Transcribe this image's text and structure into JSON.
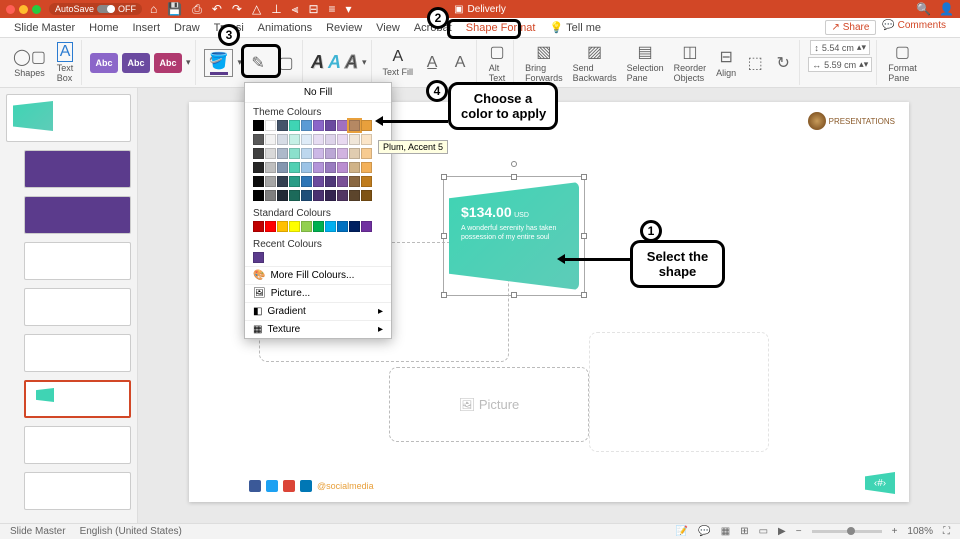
{
  "titlebar": {
    "autosave": "AutoSave",
    "off": "OFF",
    "docname": "Deliverly"
  },
  "tabs": {
    "slidemaster": "Slide Master",
    "home": "Home",
    "insert": "Insert",
    "draw": "Draw",
    "transitions": "Transitions",
    "animations": "Animations",
    "review": "Review",
    "view": "View",
    "acrobat": "Acrobat",
    "shapeformat": "Shape Format",
    "tellme": "Tell me",
    "share": "Share",
    "comments": "Comments"
  },
  "ribbon": {
    "shapes": "Shapes",
    "textbox": "Text\nBox",
    "abc": "Abc",
    "textfill": "Text Fill",
    "alttext": "Alt\nText",
    "bringfwd": "Bring\nForwards",
    "sendback": "Send\nBackwards",
    "selpane": "Selection\nPane",
    "reorder": "Reorder\nObjects",
    "align": "Align",
    "height": "5.54 cm",
    "width": "5.59 cm",
    "formatpane": "Format\nPane"
  },
  "picker": {
    "nofill": "No Fill",
    "theme": "Theme Colours",
    "standard": "Standard Colours",
    "recent": "Recent Colours",
    "more": "More Fill Colours...",
    "picture": "Picture...",
    "gradient": "Gradient",
    "texture": "Texture",
    "tooltip": "Plum, Accent 5"
  },
  "slide": {
    "price": "$134.00",
    "currency": "USD",
    "desc": "A wonderful serenity has taken possession of my entire soul",
    "placeholder": "Picture",
    "social": "@socialmedia",
    "pagenum": "‹#›",
    "brand": "PRESENTATIONS"
  },
  "callouts": {
    "n1": "1",
    "c1": "Select the\nshape",
    "n2": "2",
    "n3": "3",
    "n4": "4",
    "c4": "Choose a\ncolor to apply"
  },
  "status": {
    "mode": "Slide Master",
    "lang": "English (United States)",
    "zoom": "108%"
  }
}
